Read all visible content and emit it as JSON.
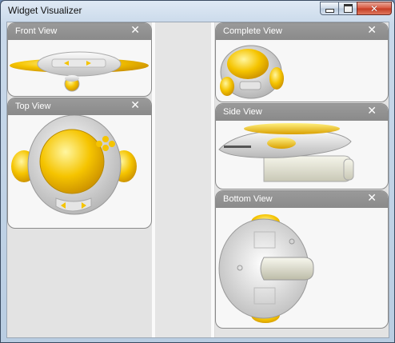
{
  "window": {
    "title": "Widget Visualizer"
  },
  "panels": {
    "front": {
      "title": "Front View",
      "close": "✕"
    },
    "top": {
      "title": "Top View",
      "close": "✕"
    },
    "complete": {
      "title": "Complete View",
      "close": "✕"
    },
    "side": {
      "title": "Side View",
      "close": "✕"
    },
    "bottom": {
      "title": "Bottom View",
      "close": "✕"
    }
  },
  "colors": {
    "accent_yellow": "#f5c400",
    "panel_header": "#8f8f8f",
    "body_silver": "#dcdcdc"
  }
}
